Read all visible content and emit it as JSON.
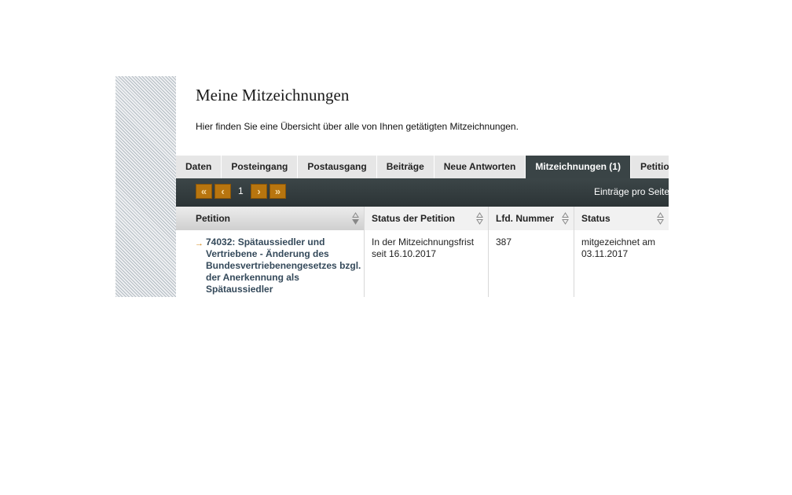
{
  "header": {
    "title": "Meine Mitzeichnungen",
    "intro": "Hier finden Sie eine Übersicht über alle von Ihnen getätigten Mitzeichnungen."
  },
  "tabs": [
    {
      "label": "Daten",
      "active": false
    },
    {
      "label": "Posteingang",
      "active": false
    },
    {
      "label": "Postausgang",
      "active": false
    },
    {
      "label": "Beiträge",
      "active": false
    },
    {
      "label": "Neue Antworten",
      "active": false
    },
    {
      "label": "Mitzeichnungen (1)",
      "active": true
    },
    {
      "label": "Petitionen",
      "active": false
    }
  ],
  "pager": {
    "first_icon": "double-chevron-left-icon",
    "prev_icon": "chevron-left-icon",
    "next_icon": "chevron-right-icon",
    "last_icon": "double-chevron-right-icon",
    "current_page": "1",
    "per_page_label": "Einträge pro Seite"
  },
  "table": {
    "columns": [
      "Petition",
      "Status der Petition",
      "Lfd. Nummer",
      "Status"
    ],
    "rows": [
      {
        "petition": "74032: Spätaussiedler und Vertriebene - Änderung des Bundesvertriebenengesetzes bzgl. der Anerkennung als Spätaussiedler",
        "status_petition": "In der Mitzeichnungsfrist seit 16.10.2017",
        "number": "387",
        "status": "mitgezeichnet am 03.11.2017"
      }
    ]
  },
  "colors": {
    "accent": "#b8750f",
    "dark_bar": "#3a4446",
    "link": "#34495a"
  }
}
